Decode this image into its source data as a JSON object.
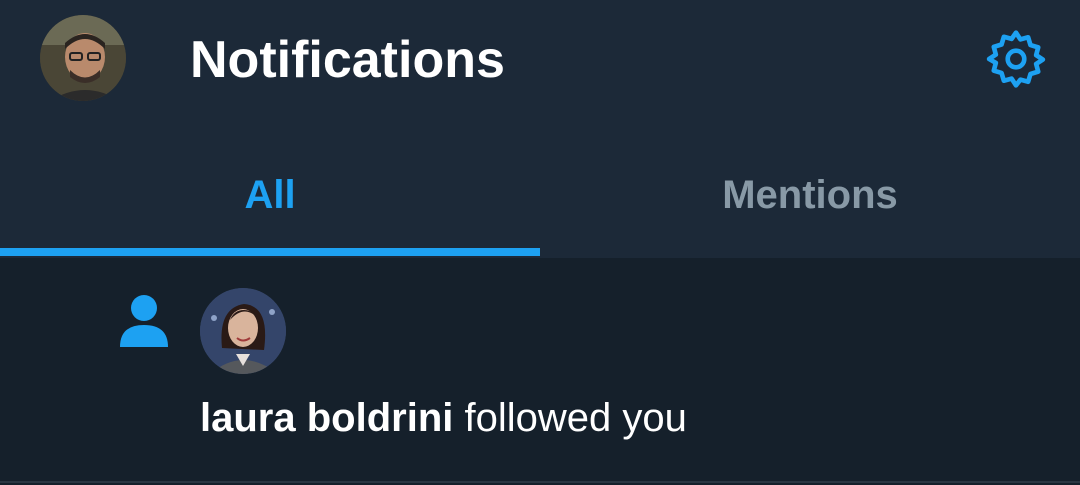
{
  "header": {
    "title": "Notifications",
    "avatar_icon": "user-avatar",
    "settings_icon": "gear-icon"
  },
  "tabs": [
    {
      "label": "All",
      "active": true
    },
    {
      "label": "Mentions",
      "active": false
    }
  ],
  "notifications": [
    {
      "type_icon": "follow-person-icon",
      "user_name": "laura boldrini",
      "action_text": " followed you"
    }
  ],
  "colors": {
    "header_bg": "#1c2938",
    "body_bg": "#15202b",
    "accent": "#1da1f2",
    "inactive_tab": "#8899a6",
    "text": "#ffffff"
  }
}
